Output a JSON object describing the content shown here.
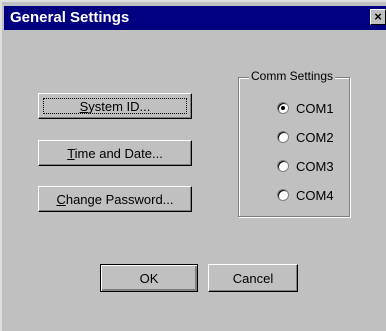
{
  "window": {
    "title": "General Settings",
    "close_glyph": "×",
    "close_icon": "close-icon"
  },
  "buttons": {
    "system_id": {
      "mnemonic": "S",
      "rest": "ystem ID..."
    },
    "time_date": {
      "mnemonic": "T",
      "rest": "ime and Date..."
    },
    "change_password": {
      "mnemonic": "C",
      "rest": "hange Password..."
    },
    "ok": "OK",
    "cancel": "Cancel"
  },
  "comm_settings": {
    "title": "Comm Settings",
    "selected": "COM1",
    "options": [
      {
        "label": "COM1",
        "checked": true
      },
      {
        "label": "COM2",
        "checked": false
      },
      {
        "label": "COM3",
        "checked": false
      },
      {
        "label": "COM4",
        "checked": false
      }
    ]
  },
  "colors": {
    "title_bar": "#000080",
    "dialog_face": "#c0c0c0"
  }
}
